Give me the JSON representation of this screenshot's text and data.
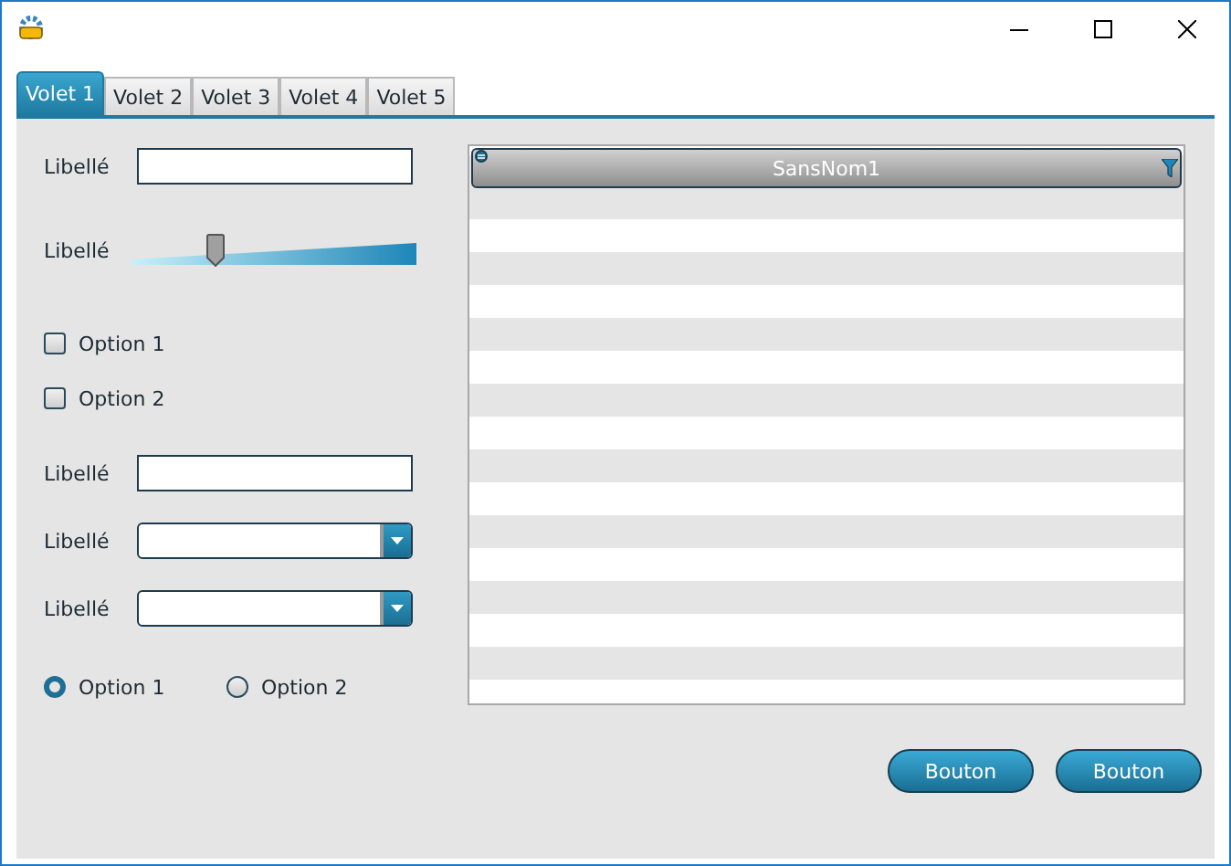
{
  "tabs": [
    {
      "label": "Volet 1",
      "selected": true
    },
    {
      "label": "Volet 2",
      "selected": false
    },
    {
      "label": "Volet 3",
      "selected": false
    },
    {
      "label": "Volet 4",
      "selected": false
    },
    {
      "label": "Volet 5",
      "selected": false
    }
  ],
  "controls": [
    {
      "kind": "field",
      "label": "Libellé"
    },
    {
      "kind": "slider",
      "label": "Libellé",
      "level": 0.28
    },
    {
      "kind": "checkbox",
      "label": "Option 1",
      "checked": false
    },
    {
      "kind": "checkbox",
      "label": "Option 2",
      "checked": false
    },
    {
      "kind": "field",
      "label": "Libellé"
    },
    {
      "kind": "combo",
      "label": "Libellé"
    },
    {
      "kind": "combo",
      "label": "Libellé"
    },
    {
      "kind": "radios",
      "options": [
        {
          "label": "Option 1",
          "selected": true
        },
        {
          "label": "Option 2",
          "selected": false
        }
      ]
    }
  ],
  "table": {
    "columns": [
      "SansNom1"
    ]
  },
  "buttons": [
    "Bouton",
    "Bouton"
  ]
}
